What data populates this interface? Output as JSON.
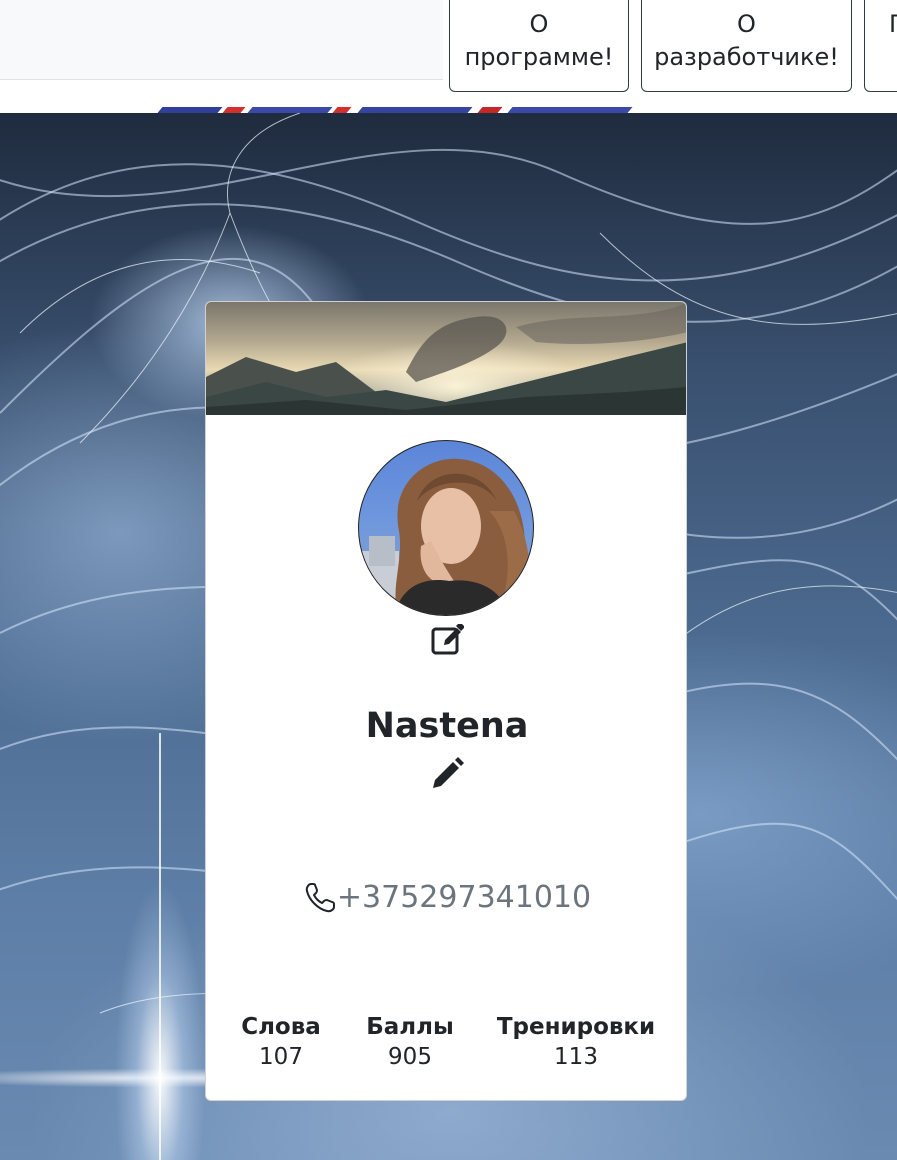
{
  "nav": {
    "buttons": [
      {
        "line1": "О",
        "line2": "программе!"
      },
      {
        "line1": "О",
        "line2": "разработчике!"
      },
      {
        "line1": "П"
      }
    ]
  },
  "profile": {
    "name": "Nastena",
    "phone": "+375297341010",
    "stats": [
      {
        "label": "Слова",
        "value": "107"
      },
      {
        "label": "Баллы",
        "value": "905"
      },
      {
        "label": "Тренировки",
        "value": "113"
      }
    ]
  },
  "icons": {
    "edit_avatar": "edit-square-icon",
    "edit_name": "pencil-icon",
    "phone": "phone-icon"
  },
  "colors": {
    "text": "#212529",
    "muted": "#6c757d",
    "border": "#343a40"
  }
}
